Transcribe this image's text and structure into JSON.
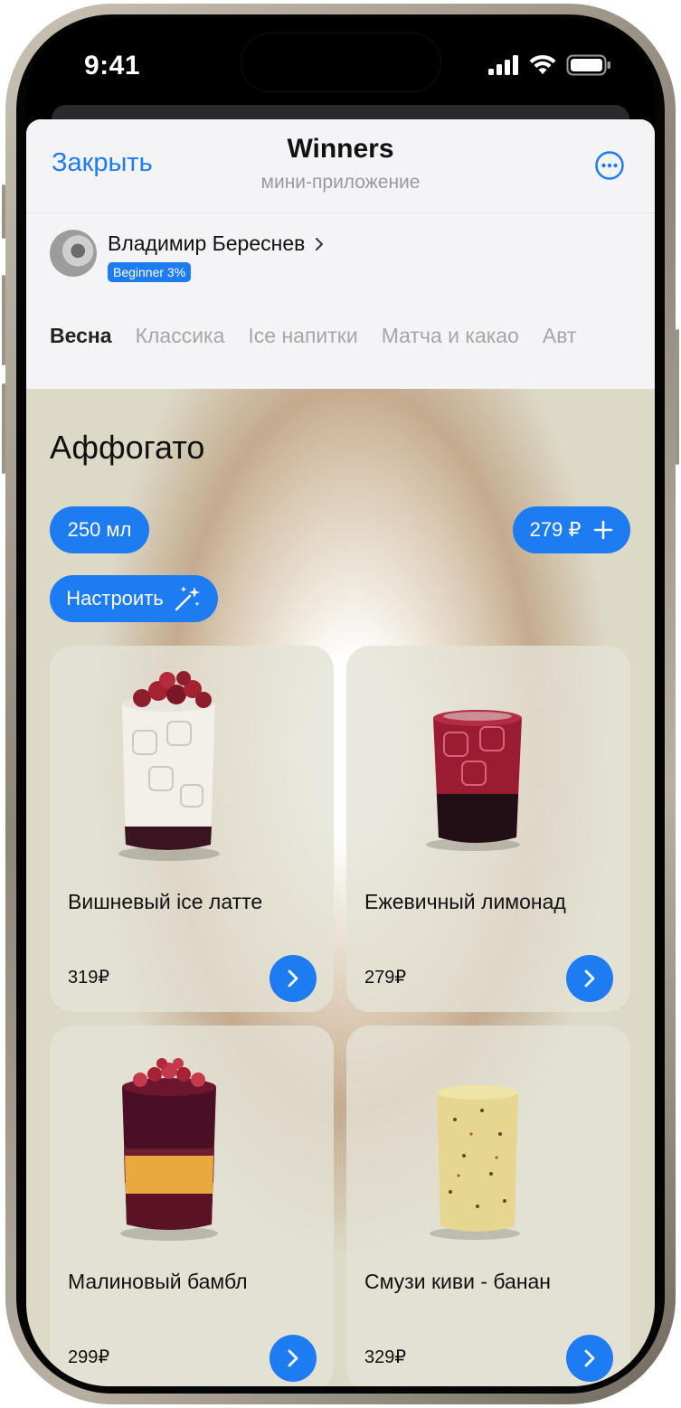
{
  "status": {
    "time": "9:41"
  },
  "header": {
    "close_label": "Закрыть",
    "title": "Winners",
    "subtitle": "мини-приложение"
  },
  "user": {
    "name": "Владимир Береснев",
    "badge": "Beginner 3%"
  },
  "categories": [
    {
      "label": "Весна",
      "active": true
    },
    {
      "label": "Классика",
      "active": false
    },
    {
      "label": "Ice напитки",
      "active": false
    },
    {
      "label": "Матча и какао",
      "active": false
    },
    {
      "label": "Авт",
      "active": false
    }
  ],
  "product": {
    "title": "Аффогато",
    "volume": "250 мл",
    "price": "279 ₽",
    "customize_label": "Настроить"
  },
  "cards": [
    {
      "name": "Вишневый ice латте",
      "price": "319₽"
    },
    {
      "name": "Ежевичный лимонад",
      "price": "279₽"
    },
    {
      "name": "Малиновый бамбл",
      "price": "299₽"
    },
    {
      "name": "Смузи киви - банан",
      "price": "329₽"
    }
  ],
  "colors": {
    "accent": "#1d7cf2",
    "sheet_bg": "#dcd9c6",
    "header_bg": "#f4f4f6"
  },
  "icons": {
    "more": "more-horizontal-circle-icon",
    "chevron": "chevron-right-icon",
    "plus": "plus-icon",
    "sparkle": "magic-wand-icon"
  }
}
